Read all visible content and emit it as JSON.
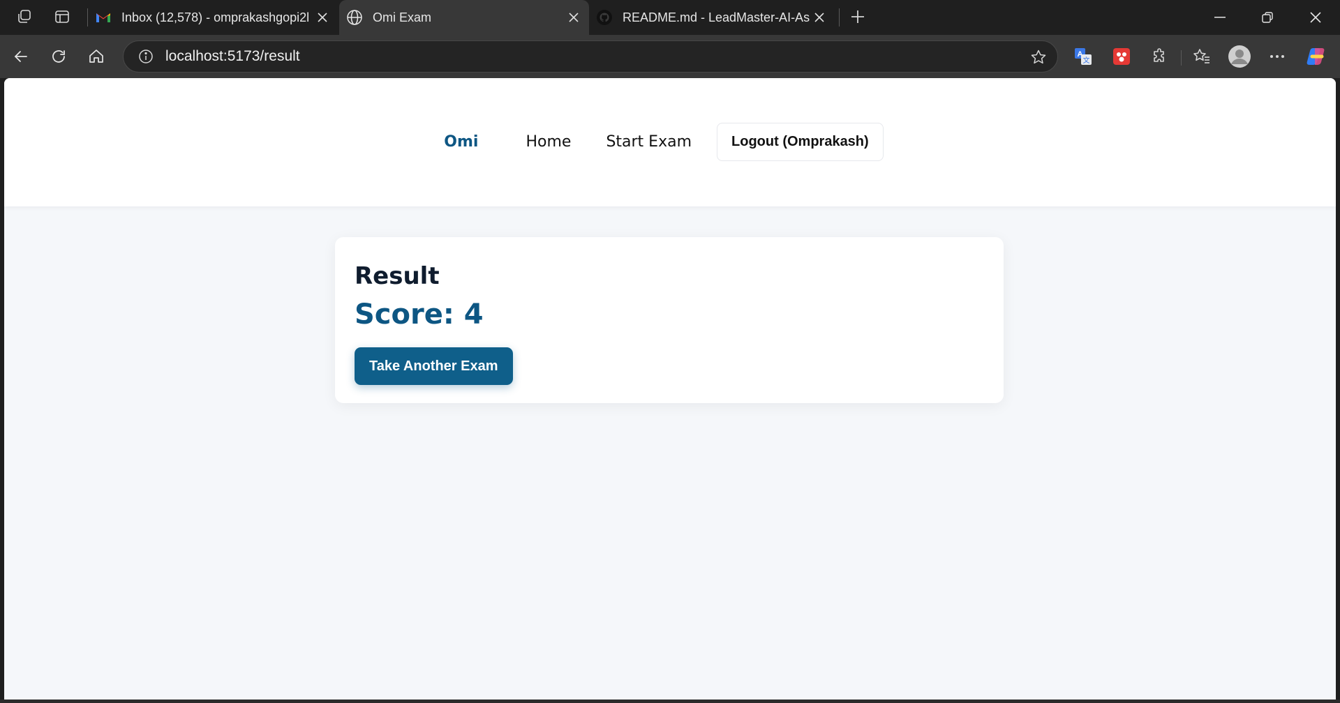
{
  "browser": {
    "tabs": [
      {
        "title": "Inbox (12,578) - omprakashgopi2l",
        "favicon": "gmail-icon",
        "active": false
      },
      {
        "title": "Omi Exam",
        "favicon": "globe-icon",
        "active": true
      },
      {
        "title": "README.md - LeadMaster-AI-Ass",
        "favicon": "github-icon",
        "active": false
      }
    ],
    "url": "localhost:5173/result"
  },
  "site": {
    "brand": "Omi",
    "nav": {
      "home": "Home",
      "start_exam": "Start Exam",
      "logout": "Logout (Omprakash)"
    }
  },
  "result": {
    "heading": "Result",
    "score_text": "Score: 4",
    "action_label": "Take Another Exam"
  },
  "colors": {
    "accent": "#0d5683",
    "button": "#0f5f8a",
    "page_bg": "#f5f7fa"
  }
}
